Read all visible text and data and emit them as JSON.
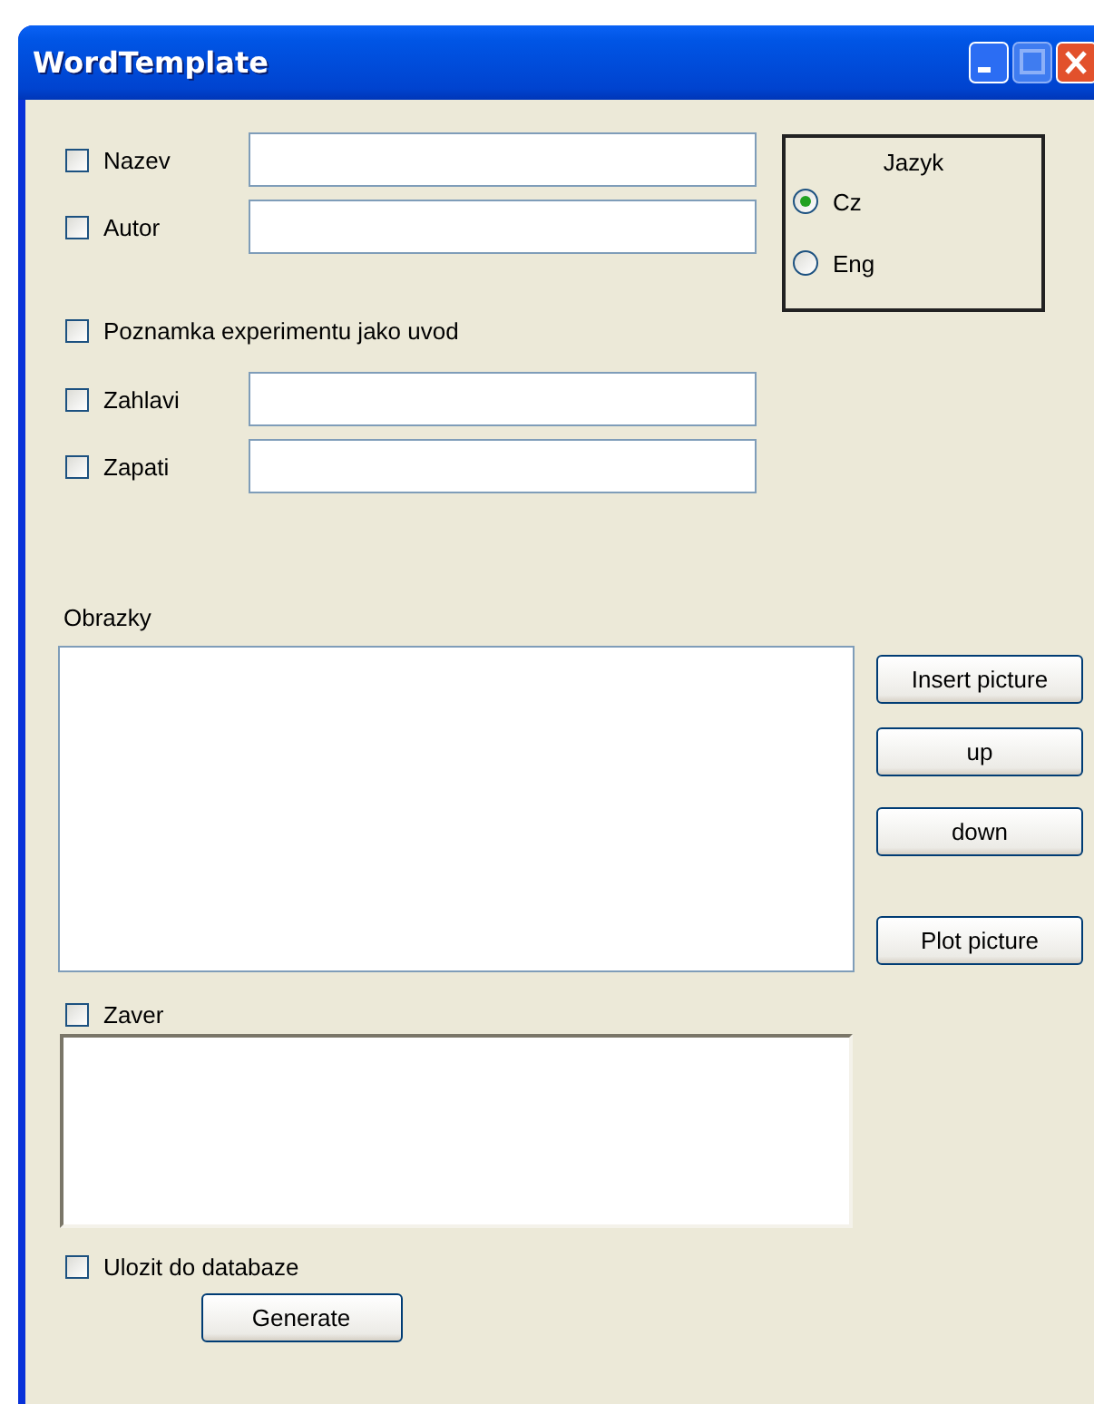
{
  "window": {
    "title": "WordTemplate"
  },
  "rows": [
    {
      "kind": "field",
      "label": "Nazev",
      "checked": false
    },
    {
      "kind": "field",
      "label": "Autor",
      "checked": false
    },
    {
      "kind": "check",
      "label": "Poznamka experimentu jako uvod",
      "checked": false
    },
    {
      "kind": "field",
      "label": "Zahlavi",
      "checked": false
    },
    {
      "kind": "field",
      "label": "Zapati",
      "checked": false
    }
  ],
  "language": {
    "title": "Jazyk",
    "options": [
      {
        "label": "Cz",
        "selected": true
      },
      {
        "label": "Eng",
        "selected": false
      }
    ]
  },
  "pictures": {
    "label": "Obrazky",
    "buttons": [
      "Insert picture",
      "up",
      "down",
      "Plot picture"
    ]
  },
  "conclusion": {
    "label": "Zaver",
    "checked": false
  },
  "save": {
    "label": "Ulozit do databaze",
    "checked": false
  },
  "generate": "Generate"
}
